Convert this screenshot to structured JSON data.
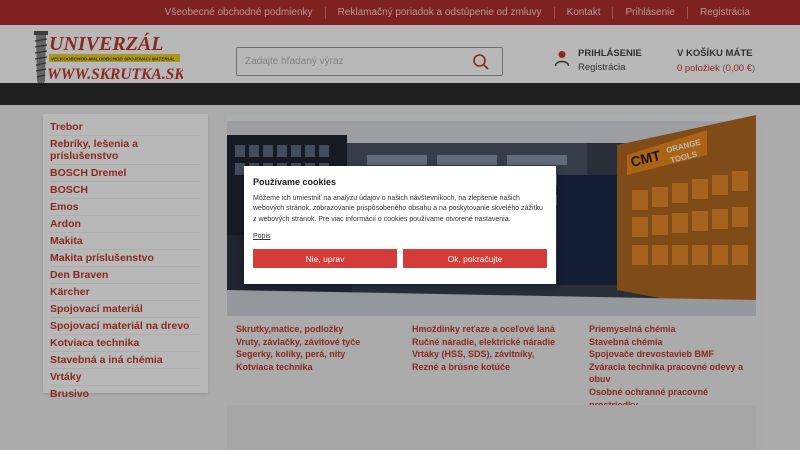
{
  "topnav": [
    "Všeobecné obchodné podmienky",
    "Reklamačný poriadok a odstúpenie od zmluvy",
    "Kontakt",
    "Prihlásenie",
    "Registrácia"
  ],
  "logo": {
    "line1": "UNIVERZÁL",
    "line2": "VEĽKOOBCHOD-MALOOBCHOD SPOJOVACÍ MATERIÁL",
    "line3": "WWW.SKRUTKA.SK"
  },
  "search": {
    "placeholder": "Zadajte hľadaný výraz"
  },
  "user": {
    "login": "PRIHLÁSENIE",
    "register": "Registrácia"
  },
  "cart": {
    "title": "V KOŠÍKU MÁTE",
    "items": "0 položiek",
    "total": "0,00 €"
  },
  "sidebar": [
    "Trebor",
    "Rebríky, lešenia a príslušenstvo",
    "BOSCH Dremel",
    "BOSCH",
    "Emos",
    "Ardon",
    "Makita",
    "Makita príslušenstvo",
    "Den Braven",
    "Kärcher",
    "Spojovací materiál",
    "Spojovací materiál na drevo",
    "Kotviaca technika",
    "Stavebná a iná chémia",
    "Vrtáky",
    "Brusivo"
  ],
  "hero": {
    "brand1": "CMT",
    "brand2": "ORANGE",
    "brand3": "TOOLS"
  },
  "categories": {
    "col1": [
      "Skrutky,matice, podložky",
      "Vruty, závlačky, závitové tyče",
      "Segerky, kolíky, perá, nity",
      "Kotviaca technika"
    ],
    "col2": [
      "Hmoždinky reťaze a oceľové laná",
      "Ručné náradie, elektrické náradie",
      "Vrtáky (HSS, SDS), závitníky,",
      "Rezné a brúsne kotúče"
    ],
    "col3": [
      "Priemyselná chémia",
      "Stavebná chémia",
      "Spojovače drevostavieb BMF",
      "Zváracia technika pracovné odevy a obuv",
      "Osobné ochranné pracovné prostriedky"
    ]
  },
  "cookie": {
    "title": "Používame cookies",
    "text": "Môžeme ich umiestniť na analýzu údajov o našich návštevníkoch, na zlepšenie našich webových stránok, zobrazovanie prispôsobeného obsahu a na poskytovanie skvelého zážitku z webových stránok. Pre viac informácií o cookies používame otvorené nastavenia.",
    "link": "Popis",
    "decline": "Nie, uprav",
    "accept": "Ok, pokračujte"
  },
  "colors": {
    "brand_red": "#b0302c",
    "link_red": "#c0392b",
    "button_red": "#d33c38",
    "dark_bar": "#2c2c2c"
  }
}
